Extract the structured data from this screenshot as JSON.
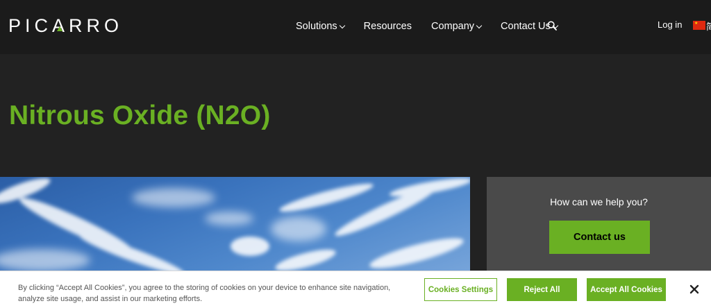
{
  "header": {
    "logo_text": "PICARRO",
    "nav": [
      {
        "label": "Solutions",
        "has_dropdown": true
      },
      {
        "label": "Resources",
        "has_dropdown": false
      },
      {
        "label": "Company",
        "has_dropdown": true
      },
      {
        "label": "Contact Us",
        "has_dropdown": true
      }
    ],
    "login_label": "Log in",
    "language_label": "简",
    "search_icon": "search-icon",
    "flag_icon": "china-flag-icon"
  },
  "hero": {
    "title": "Nitrous Oxide (N2O)"
  },
  "help_panel": {
    "prompt": "How can we help you?",
    "button_label": "Contact us"
  },
  "cookie_banner": {
    "text_line1": "By clicking “Accept All Cookies”, you agree to the storing of cookies on your device to enhance site navigation,",
    "text_line2": "analyze site usage, and assist in our marketing efforts.",
    "settings_label": "Cookies Settings",
    "reject_label": "Reject All",
    "accept_label": "Accept All Cookies",
    "close_icon": "close-icon"
  },
  "colors": {
    "brand_green": "#6ab023",
    "header_bg": "#1b1b1b",
    "page_bg": "#222222",
    "panel_bg": "#4a4a4a"
  }
}
